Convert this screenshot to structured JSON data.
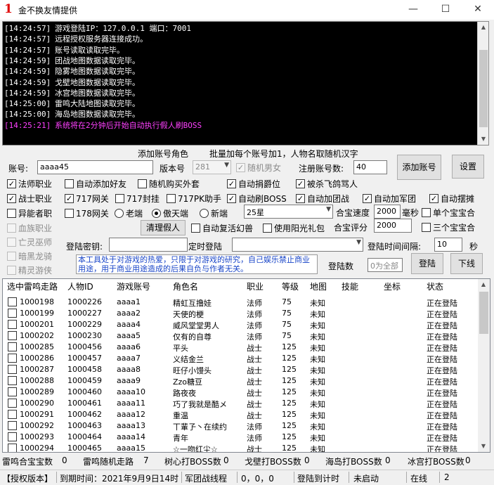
{
  "window": {
    "icon_text": "1",
    "title": "金不换友情提供",
    "minimize_glyph": "—",
    "maximize_glyph": "☐",
    "close_glyph": "✕"
  },
  "log": [
    {
      "time": "[14:24:57]",
      "text": "游戏登陆IP：127.0.0.1  端口：7001",
      "highlight": false
    },
    {
      "time": "[14:24:57]",
      "text": "远程授权服务器连接成功。",
      "highlight": false
    },
    {
      "time": "[14:24:57]",
      "text": "账号读取读取完毕。",
      "highlight": false
    },
    {
      "time": "[14:24:59]",
      "text": "团战地图数据读取完毕。",
      "highlight": false
    },
    {
      "time": "[14:24:59]",
      "text": "隐雾地图数据读取完毕。",
      "highlight": false
    },
    {
      "time": "[14:24:59]",
      "text": "戈壁地图数据读取完毕。",
      "highlight": false
    },
    {
      "time": "[14:24:59]",
      "text": "冰宫地图数据读取完毕。",
      "highlight": false
    },
    {
      "time": "[14:25:00]",
      "text": "雷鸣大陆地图读取完毕。",
      "highlight": false
    },
    {
      "time": "[14:25:00]",
      "text": "海岛地图数据读取完毕。",
      "highlight": false
    },
    {
      "time": "[14:25:21]",
      "text": "系统将在2分钟后开始自动执行假人刷BOSS",
      "highlight": true
    }
  ],
  "form": {
    "add_role_label": "添加账号角色",
    "batch_hint": "批量加每个账号加1，人物名取随机汉字",
    "account_label": "账号:",
    "account_value": "aaaa45",
    "version_label": "版本号",
    "version_value": "281",
    "random_gender_label": "随机男女",
    "register_count_label": "注册账号数:",
    "register_count_value": "40",
    "add_account_button": "添加账号",
    "settings_button": "设置",
    "clear_bots_button": "清理假人",
    "login_key_label": "登陆密钥:",
    "login_key_value": "",
    "timed_login_label": "定时登陆",
    "timed_login_value": "",
    "login_interval_label": "登陆时间间隔:",
    "login_interval_value": "10",
    "seconds_label": "秒",
    "login_count_label": "登陆数",
    "login_count_placeholder": "0为全部",
    "login_button": "登陆",
    "logout_button": "下线",
    "server_select_value": "25星",
    "treasure_speed_label": "合宝速度",
    "treasure_speed_value": "2000",
    "ms_label": "毫秒",
    "treasure_score_label": "合宝评分",
    "treasure_score_value": "2000",
    "notice_text": "本工具处于对游戏的热爱，只限于对游戏的研究，自己娱乐禁止商业用途，用于商业用途造成的后果自负与作者无关。"
  },
  "options": {
    "mage_job": {
      "label": "法师职业",
      "checked": true
    },
    "warrior_job": {
      "label": "战士职业",
      "checked": true
    },
    "ability_gain": {
      "label": "异能者职",
      "checked": false
    },
    "blood_job": {
      "label": "血族职业",
      "checked": false
    },
    "necro": {
      "label": "亡灵巫师",
      "checked": false
    },
    "dark_dragon": {
      "label": "暗黑龙骑",
      "checked": false
    },
    "elf_ranger": {
      "label": "精灵游侠",
      "checked": false
    },
    "auto_friend": {
      "label": "自动添加好友",
      "checked": false
    },
    "random_outfit": {
      "label": "随机购买外套",
      "checked": false
    },
    "auto_donate": {
      "label": "自动捐爵位",
      "checked": true
    },
    "killed_curse": {
      "label": "被杀飞鸽骂人",
      "checked": true
    },
    "net_717": {
      "label": "717网关",
      "checked": true
    },
    "seal_717": {
      "label": "717封挂",
      "checked": false
    },
    "pk_717": {
      "label": "717PK助手",
      "checked": false
    },
    "auto_boss": {
      "label": "自动刷BOSS",
      "checked": true
    },
    "auto_team": {
      "label": "自动加团战",
      "checked": true
    },
    "auto_army": {
      "label": "自动加军团",
      "checked": true
    },
    "auto_stall": {
      "label": "自动摆摊",
      "checked": true
    },
    "net_178": {
      "label": "178网关",
      "checked": false
    },
    "auto_revive": {
      "label": "自动复活幻兽",
      "checked": false
    },
    "use_sunlight": {
      "label": "使用阳光礼包",
      "checked": false
    },
    "single_treasure": {
      "label": "单个宝宝合",
      "checked": false
    },
    "triple_treasure": {
      "label": "三个宝宝合",
      "checked": false
    }
  },
  "radios": {
    "old_server": {
      "label": "老端",
      "selected": false
    },
    "aotian": {
      "label": "傲天端",
      "selected": true
    },
    "new_server": {
      "label": "新端",
      "selected": false
    }
  },
  "table": {
    "headers": [
      "选中雷鸣走路",
      "人物ID",
      "游戏账号",
      "角色名",
      "职业",
      "等级",
      "地图",
      "技能",
      "坐标",
      "状态"
    ],
    "rows": [
      [
        "1000198",
        "1000226",
        "aaaa1",
        "精虹互撸娃",
        "法师",
        "75",
        "未知",
        "",
        "",
        "正在登陆"
      ],
      [
        "1000199",
        "1000227",
        "aaaa2",
        "天使的梗",
        "法师",
        "75",
        "未知",
        "",
        "",
        "正在登陆"
      ],
      [
        "1000201",
        "1000229",
        "aaaa4",
        "威风堂堂男人",
        "法师",
        "75",
        "未知",
        "",
        "",
        "正在登陆"
      ],
      [
        "1000202",
        "1000230",
        "aaaa5",
        "仅有的自尊",
        "法师",
        "75",
        "未知",
        "",
        "",
        "正在登陆"
      ],
      [
        "1000285",
        "1000456",
        "aaaa6",
        "平头",
        "战士",
        "125",
        "未知",
        "",
        "",
        "正在登陆"
      ],
      [
        "1000286",
        "1000457",
        "aaaa7",
        "义结金兰",
        "战士",
        "125",
        "未知",
        "",
        "",
        "正在登陆"
      ],
      [
        "1000287",
        "1000458",
        "aaaa8",
        "旺仔小馒头",
        "战士",
        "125",
        "未知",
        "",
        "",
        "正在登陆"
      ],
      [
        "1000288",
        "1000459",
        "aaaa9",
        "Zzo糖豆",
        "战士",
        "125",
        "未知",
        "",
        "",
        "正在登陆"
      ],
      [
        "1000289",
        "1000460",
        "aaaa10",
        "路夜夜",
        "战士",
        "125",
        "未知",
        "",
        "",
        "正在登陆"
      ],
      [
        "1000290",
        "1000461",
        "aaaa11",
        "巧了我就是酷メ",
        "战士",
        "125",
        "未知",
        "",
        "",
        "正在登陆"
      ],
      [
        "1000291",
        "1000462",
        "aaaa12",
        "重温",
        "战士",
        "125",
        "未知",
        "",
        "",
        "正在登陆"
      ],
      [
        "1000292",
        "1000463",
        "aaaa13",
        "丅輩孒丶在续约",
        "法师",
        "125",
        "未知",
        "",
        "",
        "正在登陆"
      ],
      [
        "1000293",
        "1000464",
        "aaaa14",
        "青年",
        "法师",
        "125",
        "未知",
        "",
        "",
        "正在登陆"
      ],
      [
        "1000294",
        "1000465",
        "aaaa15",
        "☆一吻红尘☆",
        "战士",
        "125",
        "未知",
        "",
        "",
        "正在登陆"
      ]
    ]
  },
  "stats": [
    {
      "label": "雷鸣合宝宝数",
      "value": "0"
    },
    {
      "label": "雷鸣随机走路",
      "value": "7"
    },
    {
      "label": "树心打BOSS数",
      "value": "0"
    },
    {
      "label": "戈壁打BOSS数",
      "value": "0"
    },
    {
      "label": "海岛打BOSS数",
      "value": "0"
    },
    {
      "label": "冰宫打BOSS数",
      "value": "0"
    }
  ],
  "status": {
    "license": "【授权版本】",
    "expire": "到期时间：2021年9月9日14时",
    "team_route_label": "军团战线程",
    "team_route_value": "0，0，0",
    "login_timer_label": "登陆到计时",
    "login_timer_value": "未启动",
    "online_label": "在线",
    "online_value": "2"
  }
}
